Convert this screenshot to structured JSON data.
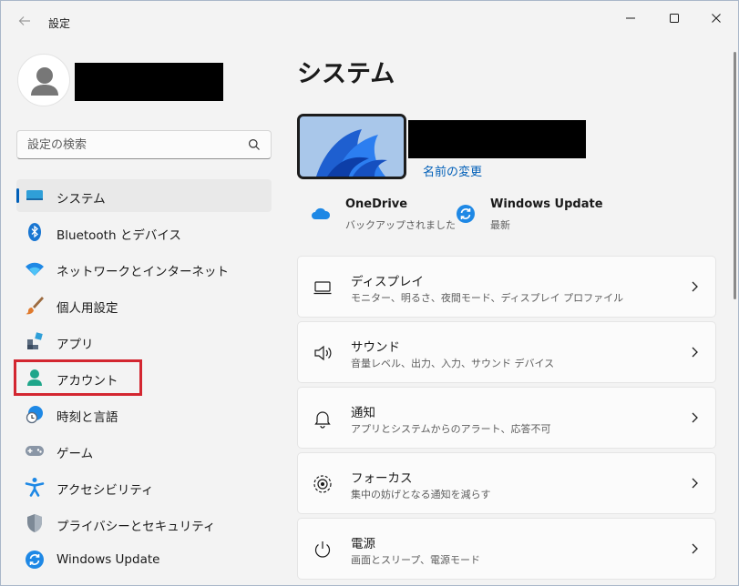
{
  "window": {
    "title": "設定"
  },
  "search": {
    "placeholder": "設定の検索"
  },
  "sidebar": {
    "items": [
      {
        "label": "システム",
        "selected": true,
        "icon": "monitor-icon"
      },
      {
        "label": "Bluetooth とデバイス",
        "icon": "bluetooth-icon"
      },
      {
        "label": "ネットワークとインターネット",
        "icon": "wifi-icon"
      },
      {
        "label": "個人用設定",
        "icon": "brush-icon"
      },
      {
        "label": "アプリ",
        "icon": "apps-icon"
      },
      {
        "label": "アカウント",
        "icon": "person-icon"
      },
      {
        "label": "時刻と言語",
        "icon": "globe-clock-icon"
      },
      {
        "label": "ゲーム",
        "icon": "gamepad-icon"
      },
      {
        "label": "アクセシビリティ",
        "icon": "accessibility-icon"
      },
      {
        "label": "プライバシーとセキュリティ",
        "icon": "shield-icon"
      },
      {
        "label": "Windows Update",
        "icon": "update-icon"
      }
    ]
  },
  "main": {
    "title": "システム",
    "rename_link": "名前の変更",
    "status": [
      {
        "title": "OneDrive",
        "subtitle": "バックアップされました",
        "icon": "cloud-icon"
      },
      {
        "title": "Windows Update",
        "subtitle": "最新",
        "icon": "update-icon"
      }
    ],
    "cards": [
      {
        "title": "ディスプレイ",
        "subtitle": "モニター、明るさ、夜間モード、ディスプレイ プロファイル",
        "icon": "display-icon"
      },
      {
        "title": "サウンド",
        "subtitle": "音量レベル、出力、入力、サウンド デバイス",
        "icon": "speaker-icon"
      },
      {
        "title": "通知",
        "subtitle": "アプリとシステムからのアラート、応答不可",
        "icon": "bell-icon"
      },
      {
        "title": "フォーカス",
        "subtitle": "集中の妨げとなる通知を減らす",
        "icon": "focus-icon"
      },
      {
        "title": "電源",
        "subtitle": "画面とスリープ、電源モード",
        "icon": "power-icon"
      }
    ]
  },
  "colors": {
    "accent": "#005fb8",
    "highlight": "#d32630"
  }
}
